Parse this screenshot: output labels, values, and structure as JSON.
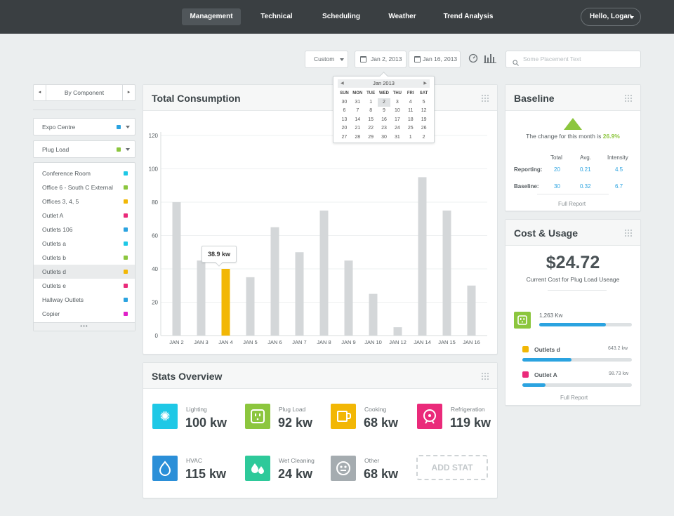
{
  "nav": {
    "tabs": [
      {
        "label": "Management",
        "active": true
      },
      {
        "label": "Technical",
        "active": false
      },
      {
        "label": "Scheduling",
        "active": false
      },
      {
        "label": "Weather",
        "active": false
      },
      {
        "label": "Trend Analysis",
        "active": false
      }
    ],
    "user": "Hello, Logan"
  },
  "toolbar": {
    "range_select": "Custom",
    "start_date": "Jan 2, 2013",
    "end_date": "Jan 16, 2013",
    "search_placeholder": "Some Placement Text"
  },
  "datepicker": {
    "month_label": "Jan  2013",
    "weekdays": [
      "SUN",
      "MON",
      "TUE",
      "WED",
      "THU",
      "FRI",
      "SAT"
    ],
    "weeks": [
      [
        "30",
        "31",
        "1",
        "2",
        "3",
        "4",
        "5"
      ],
      [
        "6",
        "7",
        "8",
        "9",
        "10",
        "11",
        "12"
      ],
      [
        "13",
        "14",
        "15",
        "16",
        "17",
        "18",
        "19"
      ],
      [
        "20",
        "21",
        "22",
        "23",
        "24",
        "25",
        "26"
      ],
      [
        "27",
        "28",
        "29",
        "30",
        "31",
        "1",
        "2"
      ]
    ],
    "selected": "2"
  },
  "left_panel": {
    "view_mode": "By Component",
    "location": {
      "label": "Expo Centre",
      "color": "#2ba3e0"
    },
    "category": {
      "label": "Plug Load",
      "color": "#8cc63e"
    },
    "items": [
      {
        "label": "Conference Room",
        "color": "#1ec8e6",
        "active": false
      },
      {
        "label": "Office 6 - South C External",
        "color": "#8cc63e",
        "active": false
      },
      {
        "label": "Offices 3, 4, 5",
        "color": "#f2b705",
        "active": false
      },
      {
        "label": "Outlet A",
        "color": "#ea2a7a",
        "active": false
      },
      {
        "label": "Outlets 106",
        "color": "#2ba3e0",
        "active": false
      },
      {
        "label": "Outlets a",
        "color": "#1ec8e6",
        "active": false
      },
      {
        "label": "Outlets b",
        "color": "#8cc63e",
        "active": false
      },
      {
        "label": "Outlets d",
        "color": "#f2b705",
        "active": true
      },
      {
        "label": "Outlets e",
        "color": "#ea2a7a",
        "active": false
      },
      {
        "label": "Hallway Outlets",
        "color": "#2ba3e0",
        "active": false
      },
      {
        "label": "Copier",
        "color": "#e020c8",
        "active": false
      }
    ]
  },
  "consumption": {
    "title": "Total Consumption",
    "tooltip": "38.9 kw"
  },
  "chart_data": {
    "type": "bar",
    "categories": [
      "JAN 2",
      "JAN 3",
      "JAN 4",
      "JAN 5",
      "JAN 6",
      "JAN 7",
      "JAN 8",
      "JAN 9",
      "JAN 10",
      "JAN 12",
      "JAN 14",
      "JAN 15",
      "JAN 16"
    ],
    "values": [
      80,
      45,
      40,
      35,
      65,
      50,
      75,
      45,
      25,
      5,
      95,
      75,
      30
    ],
    "highlight_index": 2,
    "highlight_color": "#f2b705",
    "bar_color": "#d4d7d9",
    "ylim": [
      0,
      120
    ],
    "yticks": [
      0,
      20,
      40,
      60,
      80,
      100,
      120
    ],
    "grid": true
  },
  "stats": {
    "title": "Stats Overview",
    "items": [
      {
        "label": "Lighting",
        "value": "100 kw",
        "color": "#1ec8e6",
        "icon": "bulb-icon",
        "glyph": "✺"
      },
      {
        "label": "Plug Load",
        "value": "92 kw",
        "color": "#8cc63e",
        "icon": "outlet-icon",
        "glyph": "⊡"
      },
      {
        "label": "Cooking",
        "value": "68 kw",
        "color": "#f2b705",
        "icon": "mug-icon",
        "glyph": "☕"
      },
      {
        "label": "Refrigeration",
        "value": "119 kw",
        "color": "#ea2a7a",
        "icon": "fan-icon",
        "glyph": "✻"
      },
      {
        "label": "HVAC",
        "value": "115 kw",
        "color": "#2b8fd8",
        "icon": "flame-icon",
        "glyph": "♨"
      },
      {
        "label": "Wet Cleaning",
        "value": "24 kw",
        "color": "#2ec99a",
        "icon": "droplets-icon",
        "glyph": "⁂"
      },
      {
        "label": "Other",
        "value": "68 kw",
        "color": "#a5acb0",
        "icon": "robot-icon",
        "glyph": "☻"
      }
    ],
    "add_label": "ADD STAT"
  },
  "baseline": {
    "title": "Baseline",
    "change_text": "The change for this month is",
    "change_value": "26.9%",
    "columns": [
      "Total",
      "Avg.",
      "Intensity"
    ],
    "rows": [
      {
        "label": "Reporting:",
        "values": [
          "20",
          "0.21",
          "4.5"
        ]
      },
      {
        "label": "Baseline:",
        "values": [
          "30",
          "0.32",
          "6.7"
        ]
      }
    ],
    "report_link": "Full Report"
  },
  "cost": {
    "title": "Cost & Usage",
    "amount": "$24.72",
    "caption": "Current Cost for Plug Load Useage",
    "main_usage": {
      "label": "1,263 Kw",
      "fill": 0.72,
      "color": "#2ba3e0"
    },
    "items": [
      {
        "label": "Outlets d",
        "value": "643.2 kw",
        "color": "#f2b705",
        "fill": 0.45
      },
      {
        "label": "Outlet A",
        "value": "98.73 kw",
        "color": "#ea2a7a",
        "fill": 0.21
      }
    ],
    "report_link": "Full Report"
  }
}
